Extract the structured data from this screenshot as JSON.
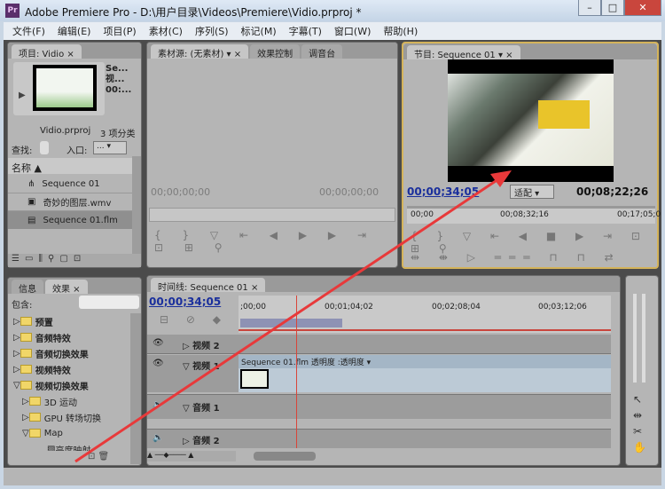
{
  "window": {
    "title": "Adobe Premiere Pro - D:\\用户目录\\Videos\\Premiere\\Vidio.prproj *",
    "logo": "Pr",
    "minimize": "–",
    "maximize": "□",
    "close": "✕"
  },
  "menu": [
    "文件(F)",
    "编辑(E)",
    "项目(P)",
    "素材(C)",
    "序列(S)",
    "标记(M)",
    "字幕(T)",
    "窗口(W)",
    "帮助(H)"
  ],
  "project": {
    "tab": "项目: Vidio",
    "close": "×",
    "preview_name": "Se...",
    "preview_type": "视...",
    "preview_time": "00:...",
    "project_file": "Vidio.prproj",
    "item_count": "3 项分类",
    "find_label": "查找:",
    "entry_label": "入口:",
    "entry_value": "...",
    "column_name": "名称",
    "items": [
      {
        "name": "Sequence 01",
        "icon": "sequence-icon"
      },
      {
        "name": "奇妙的图层.wmv",
        "icon": "video-file-icon"
      },
      {
        "name": "Sequence 01.flm",
        "icon": "film-icon",
        "selected": true
      }
    ]
  },
  "source": {
    "tabs": [
      "素材源: (无素材)",
      "效果控制",
      "调音台"
    ],
    "tc_left": "00;00;00;00",
    "tc_right": "00;00;00;00"
  },
  "program": {
    "tab": "节目: Sequence 01",
    "tc_current": "00;00;34;05",
    "fit": "适配",
    "tc_duration": "00;08;22;26",
    "ruler": [
      "00;00",
      "00;08;32;16",
      "00;17;05;0"
    ]
  },
  "effects": {
    "tabs": [
      "信息",
      "效果"
    ],
    "contains_label": "包含:",
    "items": [
      {
        "label": "预置",
        "level": 0,
        "open": false
      },
      {
        "label": "音频特效",
        "level": 0,
        "open": false
      },
      {
        "label": "音频切换效果",
        "level": 0,
        "open": false
      },
      {
        "label": "视频特效",
        "level": 0,
        "open": false
      },
      {
        "label": "视频切换效果",
        "level": 0,
        "open": true
      },
      {
        "label": "3D 运动",
        "level": 1,
        "open": false
      },
      {
        "label": "GPU 转场切换",
        "level": 1,
        "open": false
      },
      {
        "label": "Map",
        "level": 1,
        "open": true
      },
      {
        "label": "亮度映射",
        "level": 2,
        "open": false
      }
    ]
  },
  "timeline": {
    "tab": "时间线: Sequence 01",
    "tc": "00;00;34;05",
    "ruler": [
      ";00;00",
      "00;01;04;02",
      "00;02;08;04",
      "00;03;12;06"
    ],
    "tracks": [
      {
        "name": "视频 2"
      },
      {
        "name": "视频 1"
      },
      {
        "name": "音频 1"
      },
      {
        "name": "音频 2"
      }
    ],
    "clip_label": "Sequence 01.flm 透明度 :透明度 ▾"
  },
  "colors": {
    "accent_timecode": "#1a2f9c",
    "active_panel_border": "#d4b35a",
    "playhead": "#d9453a",
    "annotation_arrow": "#e8393a"
  }
}
